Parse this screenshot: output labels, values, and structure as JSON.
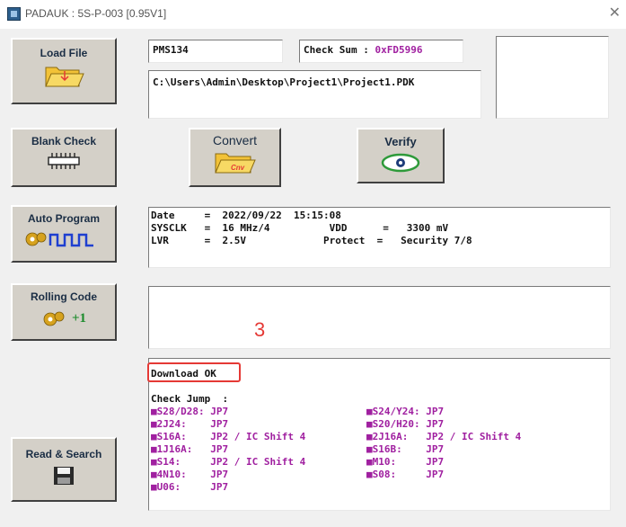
{
  "window": {
    "title": "PADAUK : 5S-P-003 [0.95V1]",
    "close_glyph": "✕"
  },
  "buttons": {
    "load_file": "Load File",
    "blank_check": "Blank Check",
    "convert": "Convert",
    "verify": "Verify",
    "auto_program": "Auto Program",
    "rolling_code": "Rolling Code",
    "rolling_plus": "+1",
    "read_search": "Read & Search"
  },
  "icons": {
    "convert_label": "Cnv"
  },
  "fields": {
    "ic_name": "PMS134",
    "checksum_label": "Check Sum : ",
    "checksum_value": "0xFD5996",
    "file_path": "C:\\Users\\Admin\\Desktop\\Project1\\Project1.PDK"
  },
  "info": {
    "date": "Date     =  2022/09/22  15:15:08",
    "line2": "SYSCLK   =  16 MHz/4          VDD      =   3300 mV",
    "line3": "LVR      =  2.5V             Protect  =   Security 7/8"
  },
  "annotation": {
    "number": "3",
    "color": "#e53935"
  },
  "status": {
    "download": "Download OK",
    "check_jump_header": "Check Jump  :",
    "jumps_left": [
      "■S28/D28: JP7",
      "■2J24:    JP7",
      "■S16A:    JP2 / IC Shift 4",
      "■1J16A:   JP7",
      "■S14:     JP2 / IC Shift 4",
      "■4N10:    JP7",
      "■U06:     JP7"
    ],
    "jumps_right": [
      "■S24/Y24: JP7",
      "■S20/H20: JP7",
      "■2J16A:   JP2 / IC Shift 4",
      "■S16B:    JP7",
      "■M10:     JP7",
      "■S08:     JP7"
    ]
  }
}
